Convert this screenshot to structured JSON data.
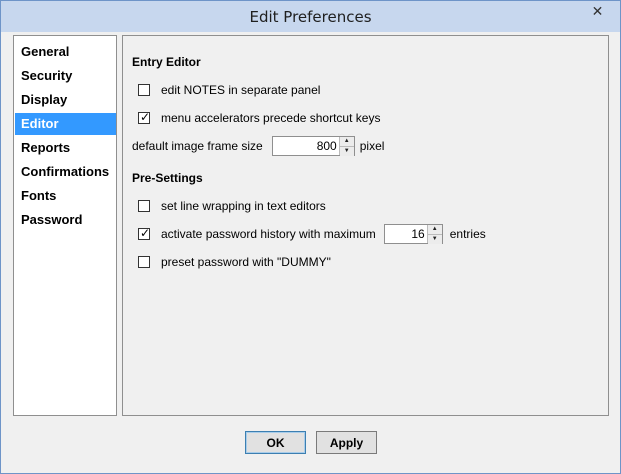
{
  "window": {
    "title": "Edit Preferences",
    "close_glyph": "✕"
  },
  "nav": {
    "items": [
      {
        "label": "General"
      },
      {
        "label": "Security"
      },
      {
        "label": "Display"
      },
      {
        "label": "Editor",
        "selected": true
      },
      {
        "label": "Reports"
      },
      {
        "label": "Confirmations"
      },
      {
        "label": "Fonts"
      },
      {
        "label": "Password"
      }
    ]
  },
  "entry_editor": {
    "heading": "Entry Editor",
    "edit_notes": {
      "label": "edit NOTES in separate panel",
      "checked": false
    },
    "menu_accelerators": {
      "label": "menu accelerators precede shortcut keys",
      "checked": true
    },
    "frame_size": {
      "label": "default image frame size",
      "value": "800",
      "unit": "pixel"
    }
  },
  "pre_settings": {
    "heading": "Pre-Settings",
    "line_wrapping": {
      "label": "set line wrapping in text editors",
      "checked": false
    },
    "password_history": {
      "label": "activate password history with maximum",
      "checked": true,
      "value": "16",
      "unit": "entries"
    },
    "preset_password": {
      "label": "preset password with \"DUMMY\"",
      "checked": false
    }
  },
  "buttons": {
    "ok": "OK",
    "apply": "Apply"
  },
  "glyphs": {
    "check": "✓",
    "spin_up": "▲",
    "spin_down": "▼"
  },
  "colors": {
    "selection": "#3399ff",
    "titlebar": "#c7d7ee"
  }
}
